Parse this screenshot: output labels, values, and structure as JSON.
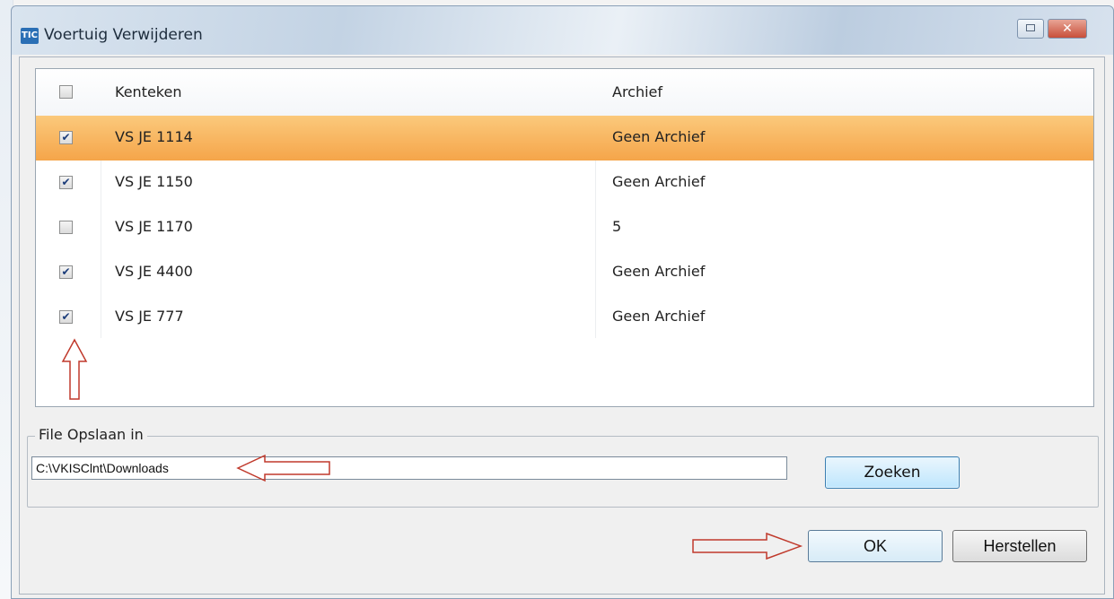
{
  "window": {
    "title": "Voertuig Verwijderen",
    "app_icon_text": "TIC",
    "close_glyph": "✕"
  },
  "grid": {
    "columns": [
      "Kenteken",
      "Archief"
    ],
    "header_checked": false,
    "rows": [
      {
        "kenteken": "VS JE 1114",
        "archief": "Geen Archief",
        "checked": true,
        "selected": true
      },
      {
        "kenteken": "VS JE 1150",
        "archief": "Geen Archief",
        "checked": true,
        "selected": false
      },
      {
        "kenteken": "VS JE 1170",
        "archief": "5",
        "checked": false,
        "selected": false
      },
      {
        "kenteken": "VS JE 4400",
        "archief": "Geen Archief",
        "checked": true,
        "selected": false
      },
      {
        "kenteken": "VS JE 777",
        "archief": "Geen Archief",
        "checked": true,
        "selected": false
      }
    ]
  },
  "save_group": {
    "legend": "File Opslaan in",
    "path_value": "C:\\VKISClnt\\Downloads",
    "browse_label": "Zoeken"
  },
  "buttons": {
    "ok_label": "OK",
    "reset_label": "Herstellen"
  },
  "colors": {
    "selected_row": "#f7b055",
    "annotation_arrow": "#c0392b"
  },
  "icons": {
    "check": "✔",
    "app": "app-icon",
    "restore": "restore-icon",
    "close": "close-icon"
  }
}
